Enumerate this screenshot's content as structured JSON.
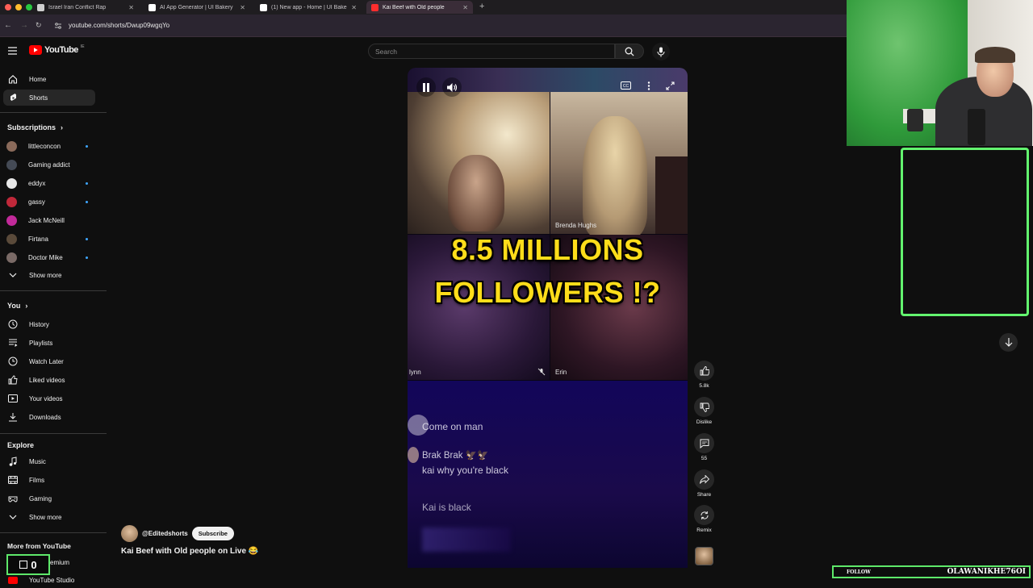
{
  "browser": {
    "tabs": [
      {
        "title": "Israel Iran Conflict Rap",
        "active": false,
        "favicon_color": "#cfcfcf"
      },
      {
        "title": "AI App Generator | UI Bakery",
        "active": false,
        "favicon_color": "#ffffff"
      },
      {
        "title": "(1) New app - Home | UI Bakery",
        "active": false,
        "favicon_color": "#ffffff"
      },
      {
        "title": "Kai Beef with Old people",
        "active": true,
        "favicon_color": "#ff2d2d"
      }
    ],
    "url": "youtube.com/shorts/Dwup09wgqYo"
  },
  "youtube": {
    "logo_text": "YouTube",
    "country": "IE",
    "search_placeholder": "Search"
  },
  "sidebar": {
    "main": [
      {
        "label": "Home",
        "icon": "home-icon"
      },
      {
        "label": "Shorts",
        "icon": "shorts-icon",
        "active": true
      }
    ],
    "subscriptions_heading": "Subscriptions",
    "subscriptions": [
      {
        "label": "littleconcon",
        "color": "#8a6a5a",
        "live": true
      },
      {
        "label": "Gaming addict",
        "color": "#444a55",
        "live": false
      },
      {
        "label": "eddyx",
        "color": "#e8e8e8",
        "live": true
      },
      {
        "label": "gassy",
        "color": "#c0283a",
        "live": true
      },
      {
        "label": "Jack McNeill",
        "color": "#c22a9a",
        "live": false
      },
      {
        "label": "Firtana",
        "color": "#5a4a3a",
        "live": true
      },
      {
        "label": "Doctor Mike",
        "color": "#7a6a66",
        "live": true
      }
    ],
    "subs_show_more": "Show more",
    "you_heading": "You",
    "you_items": [
      {
        "label": "History",
        "icon": "history-icon"
      },
      {
        "label": "Playlists",
        "icon": "playlists-icon"
      },
      {
        "label": "Watch Later",
        "icon": "watch-later-icon"
      },
      {
        "label": "Liked videos",
        "icon": "liked-icon"
      },
      {
        "label": "Your videos",
        "icon": "your-videos-icon"
      },
      {
        "label": "Downloads",
        "icon": "downloads-icon"
      }
    ],
    "explore_heading": "Explore",
    "explore_items": [
      {
        "label": "Music",
        "icon": "music-icon"
      },
      {
        "label": "Films",
        "icon": "films-icon"
      },
      {
        "label": "Gaming",
        "icon": "gaming-icon"
      }
    ],
    "explore_show_more": "Show more",
    "more_heading": "More from YouTube",
    "more_items": [
      {
        "label": "Premium"
      },
      {
        "label": "YouTube Studio"
      }
    ]
  },
  "short": {
    "caption_line1": "8.5 MILLIONS",
    "caption_line2": "FOLLOWERS !?",
    "participants": [
      "Brenda Hughs",
      "lynn",
      "Erin"
    ],
    "chat": [
      {
        "text": "Come on man"
      },
      {
        "text": "Brak Brak 🦅🦅"
      },
      {
        "text": "kai why you're black"
      },
      {
        "text": "Kai is black"
      }
    ],
    "channel": "@Editedshorts",
    "subscribe_label": "Subscribe",
    "title": "Kai Beef with Old people on Live 😂",
    "likes": "5.8k",
    "dislike_label": "Dislike",
    "comments": "55",
    "share_label": "Share",
    "remix_label": "Remix"
  },
  "overlay": {
    "follow_label": "FOLLOW",
    "follow_name": "OLAWANIKHE76OI",
    "counter_value": "0",
    "frame_color": "#5ee86a"
  }
}
